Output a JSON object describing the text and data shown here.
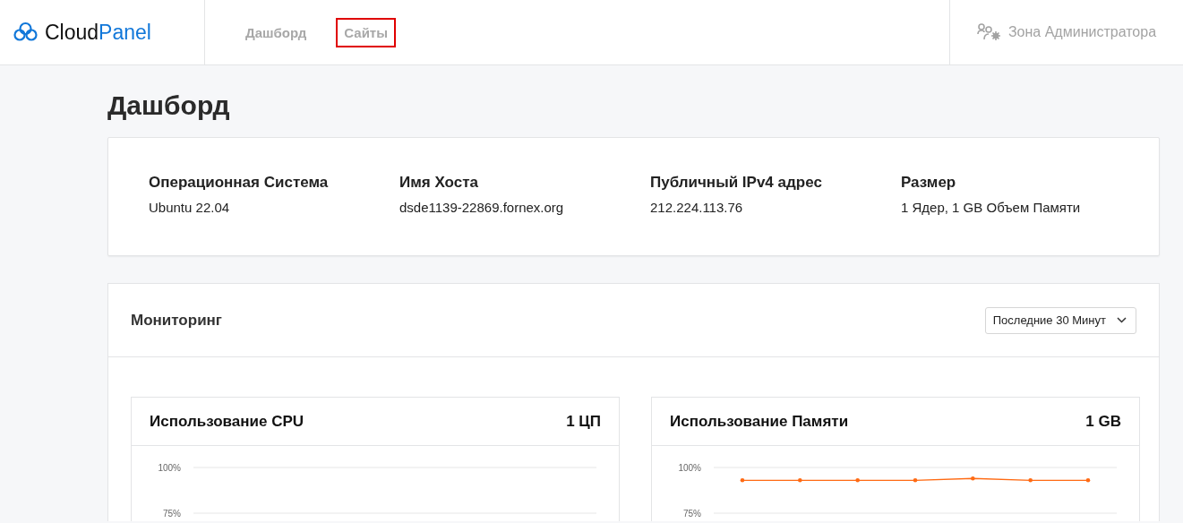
{
  "header": {
    "logo": {
      "part_1": "Cloud",
      "part_2": "Panel"
    },
    "nav": [
      {
        "label": "Дашборд",
        "highlighted": false
      },
      {
        "label": "Сайты",
        "highlighted": true
      }
    ],
    "admin_link": "Зона Администратора"
  },
  "page_title": "Дашборд",
  "server_info": [
    {
      "label": "Операционная Система",
      "value": "Ubuntu 22.04"
    },
    {
      "label": "Имя Хоста",
      "value": "dsde1139-22869.fornex.org"
    },
    {
      "label": "Публичный IPv4 адрес",
      "value": "212.224.113.76"
    },
    {
      "label": "Размер",
      "value": "1 Ядер, 1 GB Объем Памяти"
    }
  ],
  "monitoring": {
    "title": "Мониторинг",
    "period_select": "Последние 30 Минут",
    "charts": [
      {
        "title": "Использование CPU",
        "capacity": "1 ЦП",
        "axis_labels": [
          "100%",
          "75%"
        ]
      },
      {
        "title": "Использование Памяти",
        "capacity": "1 GB",
        "chart_data": {
          "type": "line",
          "ylim": [
            75,
            100
          ],
          "yticks": [
            {
              "value": 100,
              "label": "100%"
            },
            {
              "value": 75,
              "label": "75%"
            }
          ],
          "categories": [
            null,
            null,
            null,
            null,
            null,
            null,
            null
          ],
          "series": [
            {
              "color": "#ff6a13",
              "values": [
                93,
                93,
                93,
                93,
                94,
                93,
                93
              ]
            }
          ]
        }
      }
    ]
  }
}
